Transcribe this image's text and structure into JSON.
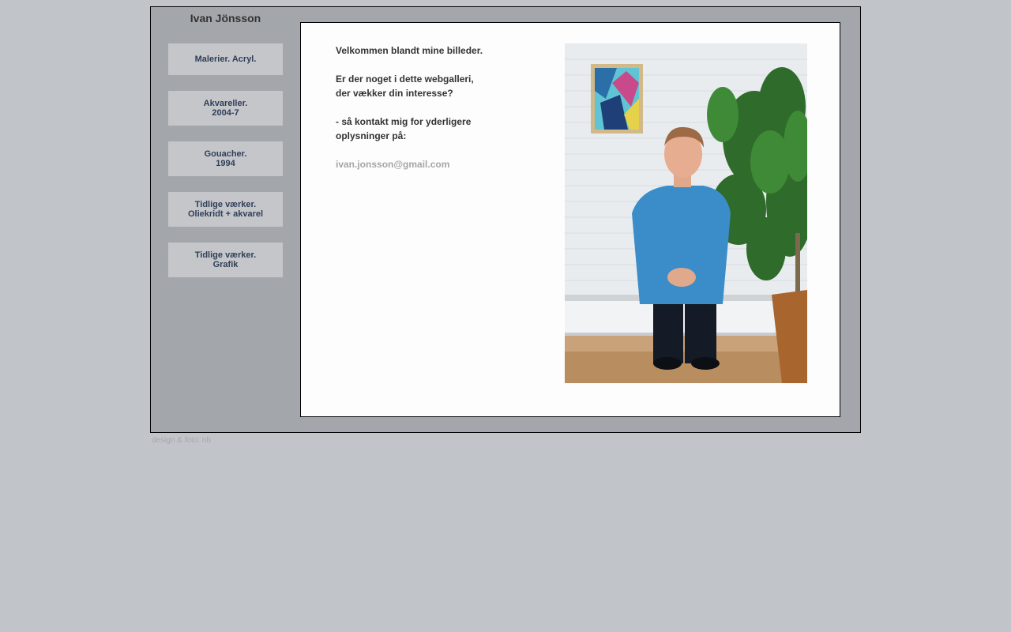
{
  "site": {
    "title": "Ivan Jönsson"
  },
  "nav": {
    "items": [
      {
        "line1": "Malerier. Acryl.",
        "line2": ""
      },
      {
        "line1": "Akvareller.",
        "line2": "2004-7"
      },
      {
        "line1": "Gouacher.",
        "line2": "1994"
      },
      {
        "line1": "Tidlige værker.",
        "line2": "Oliekridt + akvarel"
      },
      {
        "line1": "Tidlige værker.",
        "line2": "Grafik"
      }
    ]
  },
  "content": {
    "greeting": "Velkommen blandt mine billeder.",
    "question_line1": "Er der noget i dette webgalleri,",
    "question_line2": "der vækker din interesse?",
    "contact_line1": "- så kontakt mig for yderligere",
    "contact_line2": "oplysninger på:",
    "email": "ivan.jonsson@gmail.com"
  },
  "footer": {
    "credit": "design & foto: nb"
  },
  "colors": {
    "page_background": "#c1c4c8",
    "frame_background": "#a3a6ab",
    "nav_button_background": "#c4c6ca",
    "nav_text": "#2f3e57",
    "link_text": "#a5a5a5"
  }
}
